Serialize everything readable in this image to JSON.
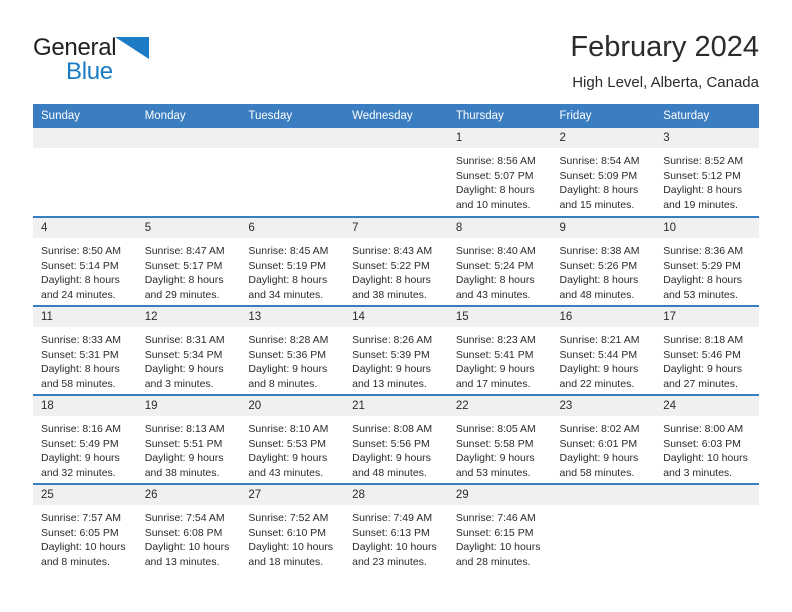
{
  "brand": {
    "name_part_1": "General",
    "name_part_2": "Blue",
    "triangle_color": "#1b7bc4",
    "text_color": "#231f20"
  },
  "header": {
    "title": "February 2024",
    "subtitle": "High Level, Alberta, Canada"
  },
  "colors": {
    "header_row_bg": "#3a7dc0",
    "header_row_text": "#ffffff",
    "daynum_bg": "#f0f0f0",
    "cell_border": "#3a7dc0",
    "body_text": "#2b2b2b"
  },
  "weekday_headers": [
    "Sunday",
    "Monday",
    "Tuesday",
    "Wednesday",
    "Thursday",
    "Friday",
    "Saturday"
  ],
  "labels": {
    "sunrise_prefix": "Sunrise:",
    "sunset_prefix": "Sunset:",
    "daylight_prefix": "Daylight:"
  },
  "weeks": [
    [
      {
        "day": "",
        "blank": true
      },
      {
        "day": "",
        "blank": true
      },
      {
        "day": "",
        "blank": true
      },
      {
        "day": "",
        "blank": true
      },
      {
        "day": "1",
        "sunrise": "Sunrise: 8:56 AM",
        "sunset": "Sunset: 5:07 PM",
        "daylight_line_1": "Daylight: 8 hours",
        "daylight_line_2": "and 10 minutes."
      },
      {
        "day": "2",
        "sunrise": "Sunrise: 8:54 AM",
        "sunset": "Sunset: 5:09 PM",
        "daylight_line_1": "Daylight: 8 hours",
        "daylight_line_2": "and 15 minutes."
      },
      {
        "day": "3",
        "sunrise": "Sunrise: 8:52 AM",
        "sunset": "Sunset: 5:12 PM",
        "daylight_line_1": "Daylight: 8 hours",
        "daylight_line_2": "and 19 minutes."
      }
    ],
    [
      {
        "day": "4",
        "sunrise": "Sunrise: 8:50 AM",
        "sunset": "Sunset: 5:14 PM",
        "daylight_line_1": "Daylight: 8 hours",
        "daylight_line_2": "and 24 minutes."
      },
      {
        "day": "5",
        "sunrise": "Sunrise: 8:47 AM",
        "sunset": "Sunset: 5:17 PM",
        "daylight_line_1": "Daylight: 8 hours",
        "daylight_line_2": "and 29 minutes."
      },
      {
        "day": "6",
        "sunrise": "Sunrise: 8:45 AM",
        "sunset": "Sunset: 5:19 PM",
        "daylight_line_1": "Daylight: 8 hours",
        "daylight_line_2": "and 34 minutes."
      },
      {
        "day": "7",
        "sunrise": "Sunrise: 8:43 AM",
        "sunset": "Sunset: 5:22 PM",
        "daylight_line_1": "Daylight: 8 hours",
        "daylight_line_2": "and 38 minutes."
      },
      {
        "day": "8",
        "sunrise": "Sunrise: 8:40 AM",
        "sunset": "Sunset: 5:24 PM",
        "daylight_line_1": "Daylight: 8 hours",
        "daylight_line_2": "and 43 minutes."
      },
      {
        "day": "9",
        "sunrise": "Sunrise: 8:38 AM",
        "sunset": "Sunset: 5:26 PM",
        "daylight_line_1": "Daylight: 8 hours",
        "daylight_line_2": "and 48 minutes."
      },
      {
        "day": "10",
        "sunrise": "Sunrise: 8:36 AM",
        "sunset": "Sunset: 5:29 PM",
        "daylight_line_1": "Daylight: 8 hours",
        "daylight_line_2": "and 53 minutes."
      }
    ],
    [
      {
        "day": "11",
        "sunrise": "Sunrise: 8:33 AM",
        "sunset": "Sunset: 5:31 PM",
        "daylight_line_1": "Daylight: 8 hours",
        "daylight_line_2": "and 58 minutes."
      },
      {
        "day": "12",
        "sunrise": "Sunrise: 8:31 AM",
        "sunset": "Sunset: 5:34 PM",
        "daylight_line_1": "Daylight: 9 hours",
        "daylight_line_2": "and 3 minutes."
      },
      {
        "day": "13",
        "sunrise": "Sunrise: 8:28 AM",
        "sunset": "Sunset: 5:36 PM",
        "daylight_line_1": "Daylight: 9 hours",
        "daylight_line_2": "and 8 minutes."
      },
      {
        "day": "14",
        "sunrise": "Sunrise: 8:26 AM",
        "sunset": "Sunset: 5:39 PM",
        "daylight_line_1": "Daylight: 9 hours",
        "daylight_line_2": "and 13 minutes."
      },
      {
        "day": "15",
        "sunrise": "Sunrise: 8:23 AM",
        "sunset": "Sunset: 5:41 PM",
        "daylight_line_1": "Daylight: 9 hours",
        "daylight_line_2": "and 17 minutes."
      },
      {
        "day": "16",
        "sunrise": "Sunrise: 8:21 AM",
        "sunset": "Sunset: 5:44 PM",
        "daylight_line_1": "Daylight: 9 hours",
        "daylight_line_2": "and 22 minutes."
      },
      {
        "day": "17",
        "sunrise": "Sunrise: 8:18 AM",
        "sunset": "Sunset: 5:46 PM",
        "daylight_line_1": "Daylight: 9 hours",
        "daylight_line_2": "and 27 minutes."
      }
    ],
    [
      {
        "day": "18",
        "sunrise": "Sunrise: 8:16 AM",
        "sunset": "Sunset: 5:49 PM",
        "daylight_line_1": "Daylight: 9 hours",
        "daylight_line_2": "and 32 minutes."
      },
      {
        "day": "19",
        "sunrise": "Sunrise: 8:13 AM",
        "sunset": "Sunset: 5:51 PM",
        "daylight_line_1": "Daylight: 9 hours",
        "daylight_line_2": "and 38 minutes."
      },
      {
        "day": "20",
        "sunrise": "Sunrise: 8:10 AM",
        "sunset": "Sunset: 5:53 PM",
        "daylight_line_1": "Daylight: 9 hours",
        "daylight_line_2": "and 43 minutes."
      },
      {
        "day": "21",
        "sunrise": "Sunrise: 8:08 AM",
        "sunset": "Sunset: 5:56 PM",
        "daylight_line_1": "Daylight: 9 hours",
        "daylight_line_2": "and 48 minutes."
      },
      {
        "day": "22",
        "sunrise": "Sunrise: 8:05 AM",
        "sunset": "Sunset: 5:58 PM",
        "daylight_line_1": "Daylight: 9 hours",
        "daylight_line_2": "and 53 minutes."
      },
      {
        "day": "23",
        "sunrise": "Sunrise: 8:02 AM",
        "sunset": "Sunset: 6:01 PM",
        "daylight_line_1": "Daylight: 9 hours",
        "daylight_line_2": "and 58 minutes."
      },
      {
        "day": "24",
        "sunrise": "Sunrise: 8:00 AM",
        "sunset": "Sunset: 6:03 PM",
        "daylight_line_1": "Daylight: 10 hours",
        "daylight_line_2": "and 3 minutes."
      }
    ],
    [
      {
        "day": "25",
        "sunrise": "Sunrise: 7:57 AM",
        "sunset": "Sunset: 6:05 PM",
        "daylight_line_1": "Daylight: 10 hours",
        "daylight_line_2": "and 8 minutes."
      },
      {
        "day": "26",
        "sunrise": "Sunrise: 7:54 AM",
        "sunset": "Sunset: 6:08 PM",
        "daylight_line_1": "Daylight: 10 hours",
        "daylight_line_2": "and 13 minutes."
      },
      {
        "day": "27",
        "sunrise": "Sunrise: 7:52 AM",
        "sunset": "Sunset: 6:10 PM",
        "daylight_line_1": "Daylight: 10 hours",
        "daylight_line_2": "and 18 minutes."
      },
      {
        "day": "28",
        "sunrise": "Sunrise: 7:49 AM",
        "sunset": "Sunset: 6:13 PM",
        "daylight_line_1": "Daylight: 10 hours",
        "daylight_line_2": "and 23 minutes."
      },
      {
        "day": "29",
        "sunrise": "Sunrise: 7:46 AM",
        "sunset": "Sunset: 6:15 PM",
        "daylight_line_1": "Daylight: 10 hours",
        "daylight_line_2": "and 28 minutes."
      },
      {
        "day": "",
        "blank": true
      },
      {
        "day": "",
        "blank": true
      }
    ]
  ]
}
